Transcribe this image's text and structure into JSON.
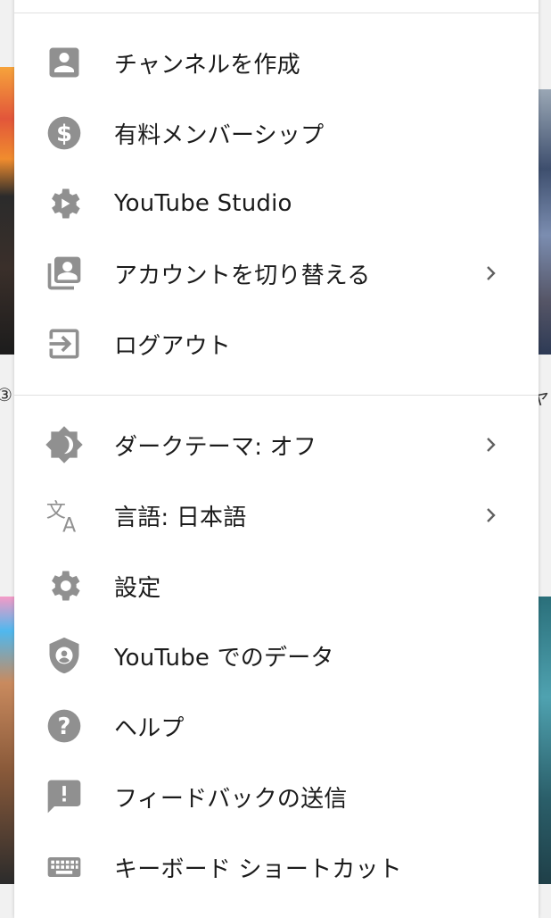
{
  "menu": {
    "section1": [
      {
        "label": "チャンネルを作成",
        "icon": "account-box-icon",
        "submenu": false
      },
      {
        "label": "有料メンバーシップ",
        "icon": "dollar-icon",
        "submenu": false
      },
      {
        "label": "YouTube Studio",
        "icon": "studio-gear-icon",
        "submenu": false
      },
      {
        "label": "アカウントを切り替える",
        "icon": "switch-account-icon",
        "submenu": true
      },
      {
        "label": "ログアウト",
        "icon": "logout-icon",
        "submenu": false
      }
    ],
    "section2": [
      {
        "label": "ダークテーマ: オフ",
        "icon": "dark-theme-icon",
        "submenu": true
      },
      {
        "label": "言語: 日本語",
        "icon": "translate-icon",
        "submenu": true
      },
      {
        "label": "設定",
        "icon": "settings-icon",
        "submenu": false
      },
      {
        "label": "YouTube でのデータ",
        "icon": "shield-user-icon",
        "submenu": false
      },
      {
        "label": "ヘルプ",
        "icon": "help-icon",
        "submenu": false
      },
      {
        "label": "フィードバックの送信",
        "icon": "feedback-icon",
        "submenu": false
      },
      {
        "label": "キーボード ショートカット",
        "icon": "keyboard-icon",
        "submenu": false
      }
    ]
  },
  "colors": {
    "icon": "#909090",
    "text": "#1b1b1b",
    "divider": "#e0e0e0",
    "panel": "#ffffff"
  },
  "background": {
    "left_fragment": "③",
    "right_fragment": "ヤ"
  }
}
